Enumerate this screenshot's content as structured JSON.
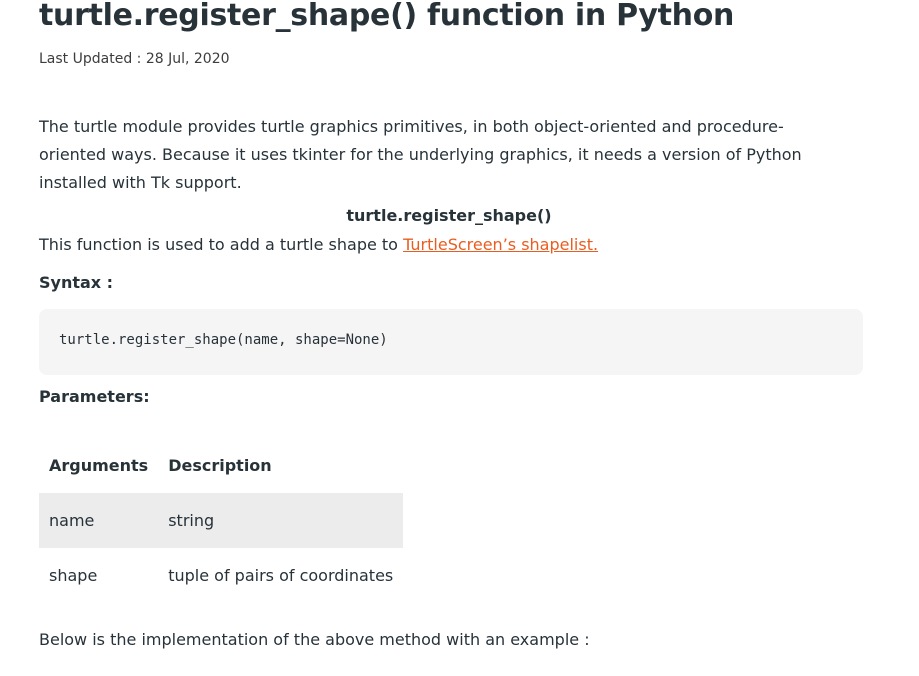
{
  "article": {
    "title": "turtle.register_shape() function in Python",
    "last_updated": "Last Updated : 28 Jul, 2020",
    "intro": "The turtle module provides turtle graphics primitives, in both object-oriented and procedure-oriented ways. Because it uses tkinter for the underlying graphics, it needs a version of Python installed with Tk support.",
    "function_heading": "turtle.register_shape()",
    "function_desc_prefix": "This function is used to add a turtle shape to ",
    "function_desc_link": "TurtleScreen’s shapelist.",
    "syntax_label": "Syntax :",
    "syntax_code": "turtle.register_shape(name, shape=None)",
    "parameters_label": "Parameters:",
    "table": {
      "headers": [
        "Arguments",
        "Description"
      ],
      "rows": [
        [
          "name",
          "string"
        ],
        [
          "shape",
          "tuple of pairs of coordinates"
        ]
      ]
    },
    "implementation_text": "Below is the implementation of the above method with an example :"
  },
  "colors": {
    "text": "#273239",
    "link": "#e95d20",
    "code_bg": "#f5f5f5",
    "row_shade": "#ececec"
  }
}
